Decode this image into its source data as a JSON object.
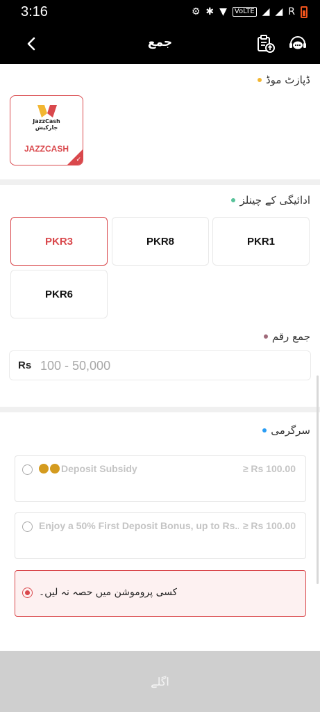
{
  "status_bar": {
    "time": "3:16",
    "network": "VoLTE",
    "roaming": "R"
  },
  "header": {
    "title": "جمع"
  },
  "deposit_mode": {
    "label": "ڈپازٹ موڈ",
    "dot_color": "#f2b632",
    "method": {
      "logo_text_en": "JazzCash",
      "logo_text_ur": "جازکیش",
      "name": "JAZZCASH"
    }
  },
  "channels": {
    "label": "ادائیگی کے چینلز",
    "dot_color": "#58c29a",
    "items": [
      "PKR3",
      "PKR8",
      "PKR1",
      "PKR6"
    ],
    "selected": "PKR3"
  },
  "amount": {
    "label": "جمع رقم",
    "dot_color": "#a06a7a",
    "currency": "Rs",
    "placeholder": "100 - 50,000",
    "value": ""
  },
  "activity": {
    "label": "سرگرمی",
    "dot_color": "#2a9df4",
    "promos": [
      {
        "text": "Deposit Subsidy",
        "amount": "≥ Rs 100.00",
        "icon": "money-bag-icon",
        "selected": false
      },
      {
        "text": "Enjoy a 50% First Deposit Bonus, up to Rs...",
        "amount": "≥ Rs 100.00",
        "selected": false
      },
      {
        "text": "کسی پروموشن میں حصہ نہ لیں۔",
        "selected": true
      }
    ]
  },
  "footer": {
    "next_label": "اگلے"
  },
  "colors": {
    "accent": "#d9484c",
    "header_bg": "#000000",
    "disabled_button": "#cfcfcf"
  }
}
